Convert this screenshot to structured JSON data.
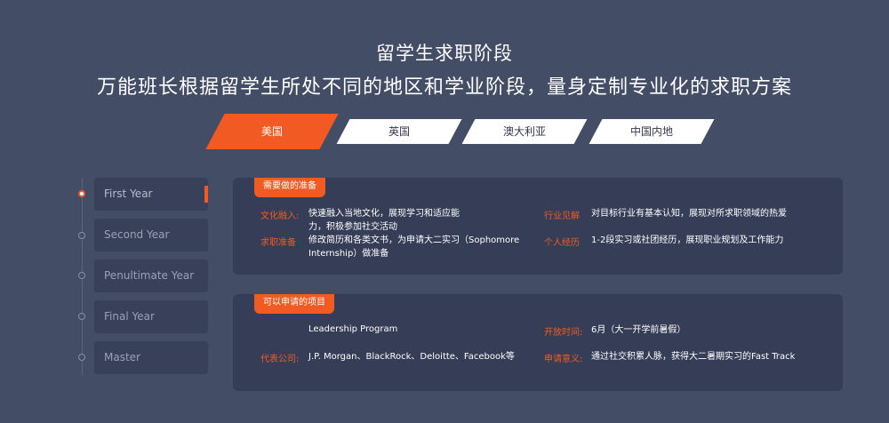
{
  "header": {
    "title": "留学生求职阶段",
    "subtitle": "万能班长根据留学生所处不同的地区和学业阶段，量身定制专业化的求职方案"
  },
  "regions": [
    {
      "label": "美国",
      "active": true
    },
    {
      "label": "英国",
      "active": false
    },
    {
      "label": "澳大利亚",
      "active": false
    },
    {
      "label": "中国内地",
      "active": false
    }
  ],
  "stages": [
    {
      "label": "First Year",
      "active": true
    },
    {
      "label": "Second Year",
      "active": false
    },
    {
      "label": "Penultimate Year",
      "active": false
    },
    {
      "label": "Final Year",
      "active": false
    },
    {
      "label": "Master",
      "active": false
    }
  ],
  "prep": {
    "tag": "需要做的准备",
    "culture_label": "文化融入:",
    "culture_value": "快速融入当地文化，展现学习和适应能力，积极参加社交活动",
    "job_label": "求职准备",
    "job_value": "修改简历和各类文书，为申请大二实习（Sophomore Internship）做准备",
    "industry_label": "行业见解",
    "industry_value": "对目标行业有基本认知，展现对所求职领域的热爱",
    "personal_label": "个人经历",
    "personal_value": "1-2段实习或社团经历，展现职业规划及工作能力"
  },
  "projects": {
    "tag": "可以申请的项目",
    "program_value": "Leadership Program",
    "company_label": "代表公司:",
    "company_value": "J.P. Morgan、BlackRock、Deloitte、Facebook等",
    "open_label": "开放时间:",
    "open_value": "6月（大一开学前暑假）",
    "meaning_label": "申请意义:",
    "meaning_value": "通过社交积累人脉，获得大二暑期实习的Fast Track"
  },
  "colors": {
    "background": "#444d66",
    "card": "#363e57",
    "accent": "#f15a22",
    "stage_bg": "#39415a"
  }
}
